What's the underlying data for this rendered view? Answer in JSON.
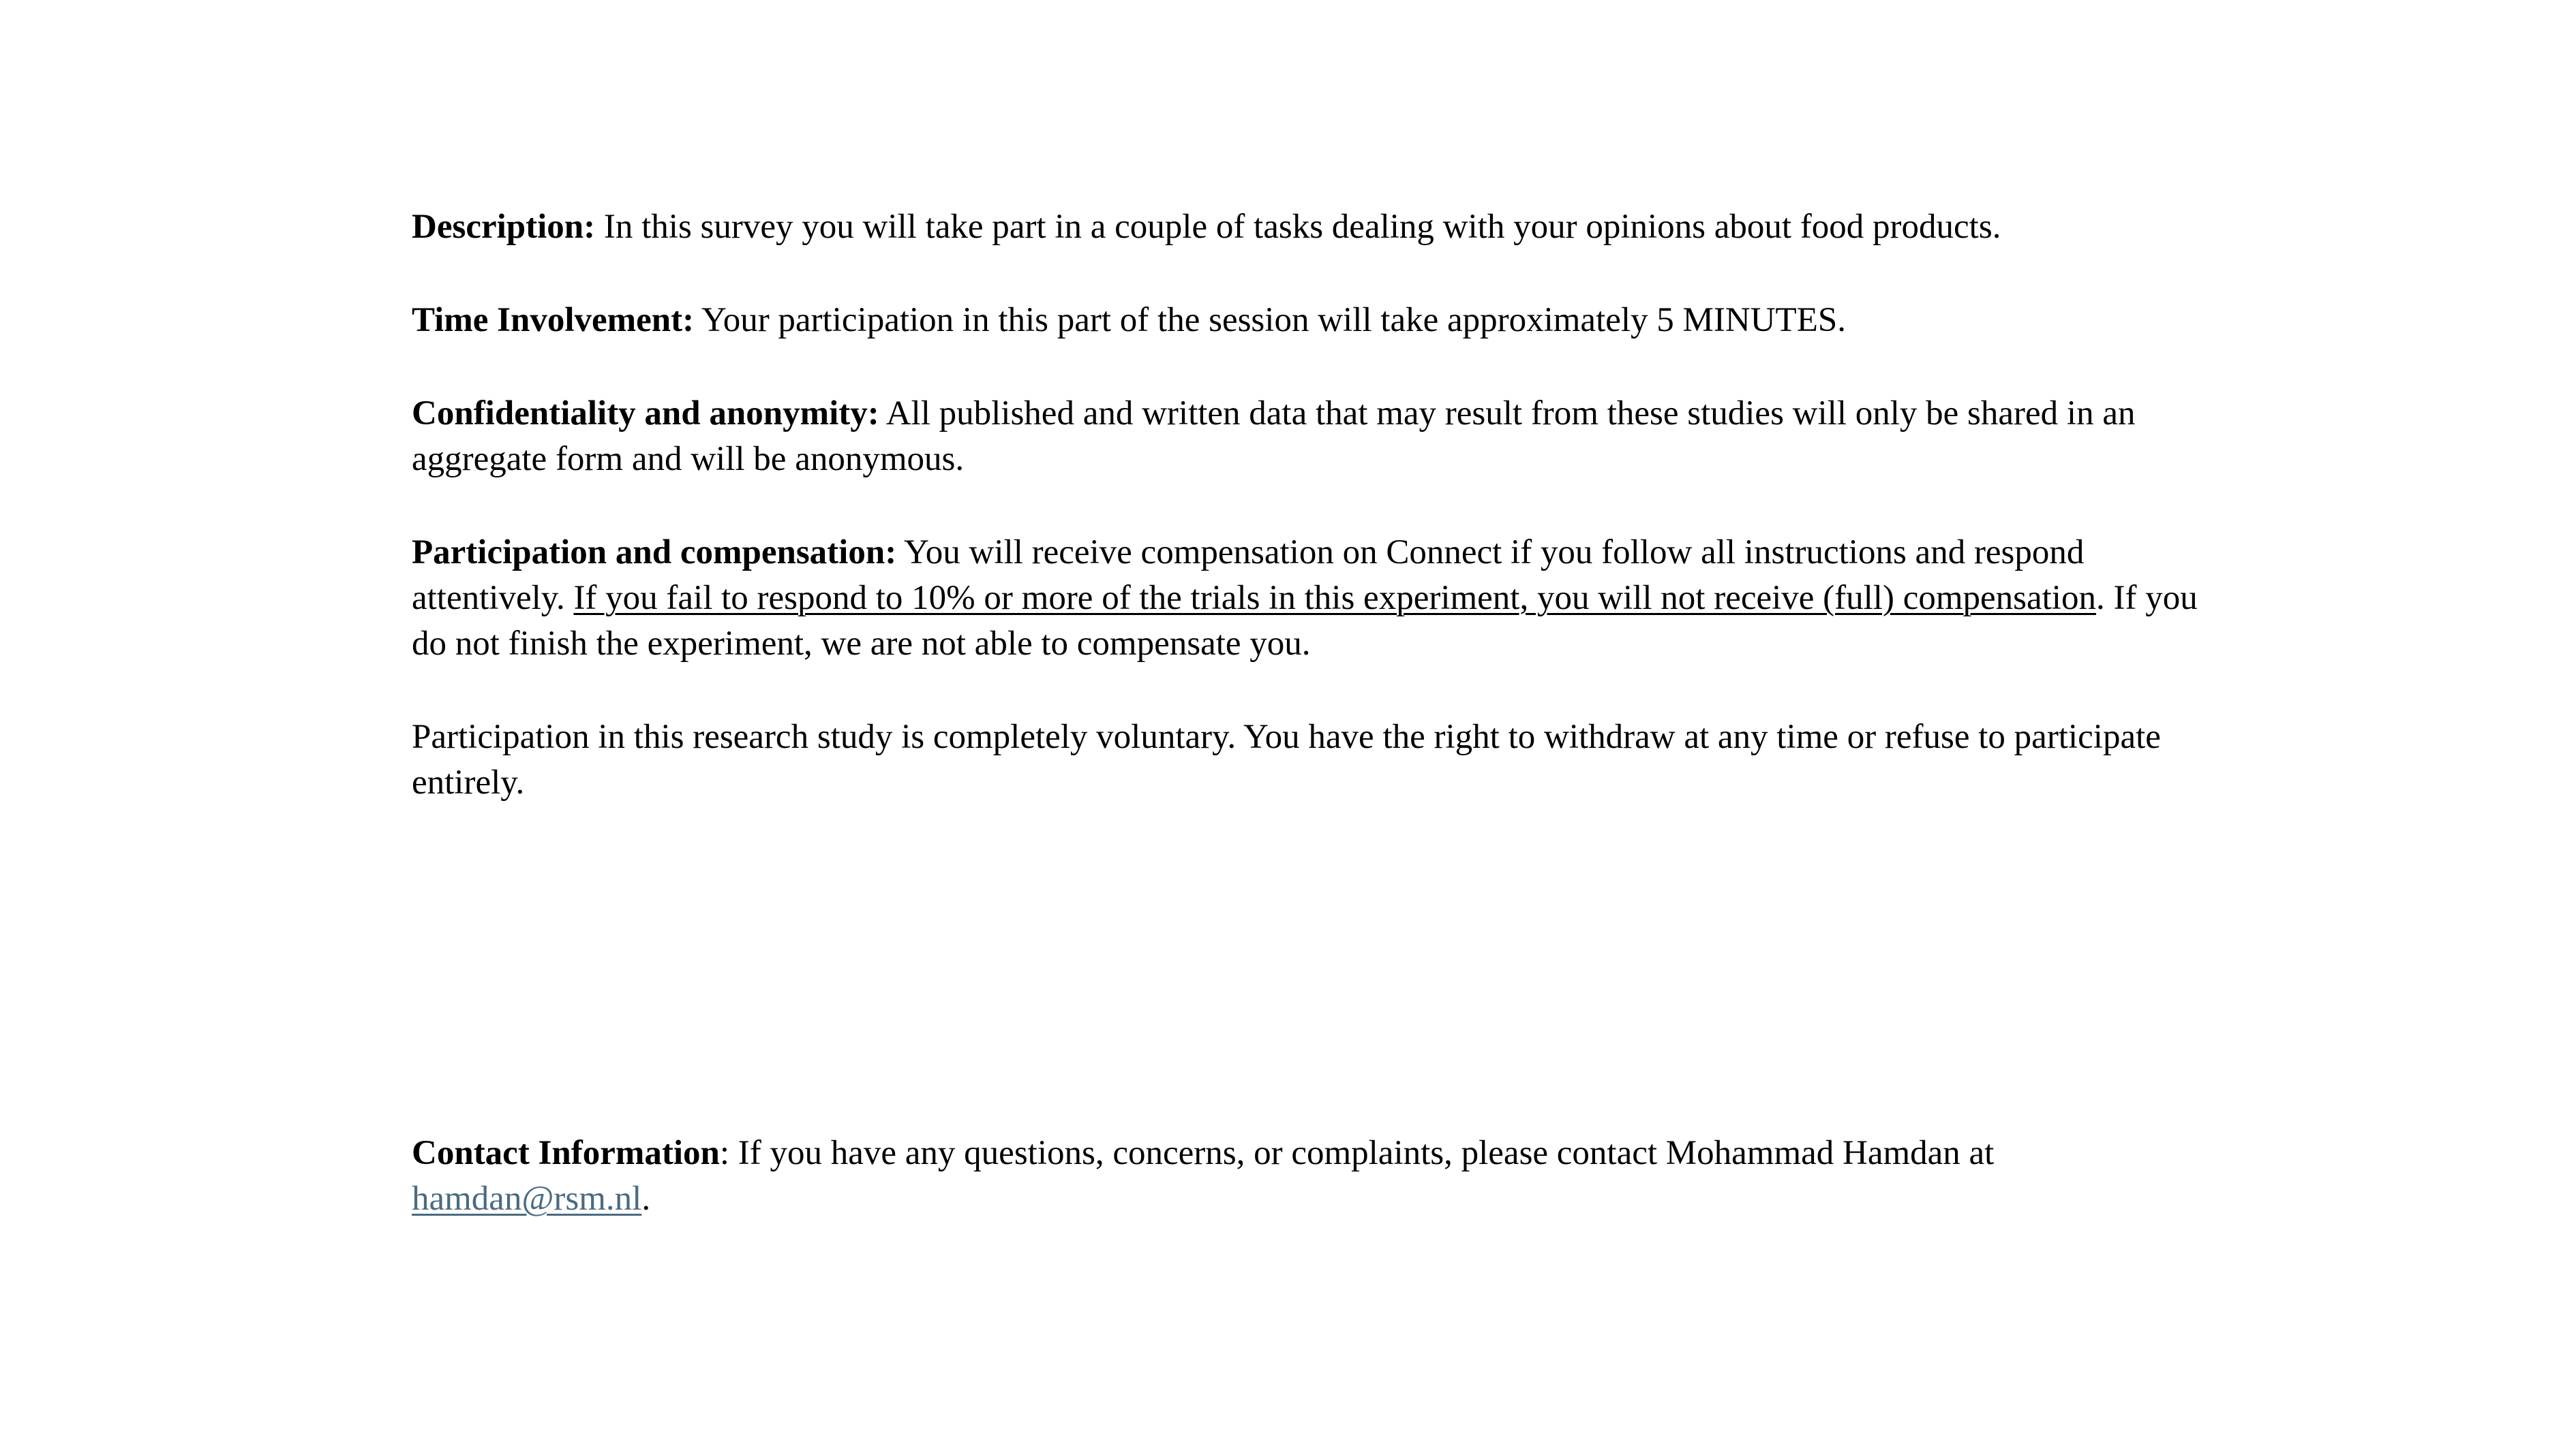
{
  "description": {
    "label": "Description:",
    "text": " In this survey you will take part in a couple of tasks dealing with your opinions about food products."
  },
  "time_involvement": {
    "label": "Time Involvement:",
    "text": " Your participation in this part of the session will take approximately 5 MINUTES."
  },
  "confidentiality": {
    "label": "Confidentiality and anonymity:",
    "text": " All published and written data that may result from these studies will only be shared in an aggregate form and will be anonymous."
  },
  "participation": {
    "label": "Participation and compensation:",
    "text_before": " You will receive compensation on Connect if you follow all instructions and respond attentively. ",
    "underlined": "If you fail to respond to 10% or more of the trials in this experiment, you will not receive (full) compensation",
    "text_after": ". If you do not finish the experiment, we are not able to compensate you."
  },
  "voluntary": {
    "text": "Participation in this research study is completely voluntary. You have the right to withdraw at any time or refuse to participate entirely."
  },
  "contact": {
    "label": "Contact Information",
    "text": ": If you have any questions, concerns, or complaints, please contact Mohammad Hamdan at ",
    "email": "hamdan@rsm.nl",
    "end": "."
  }
}
